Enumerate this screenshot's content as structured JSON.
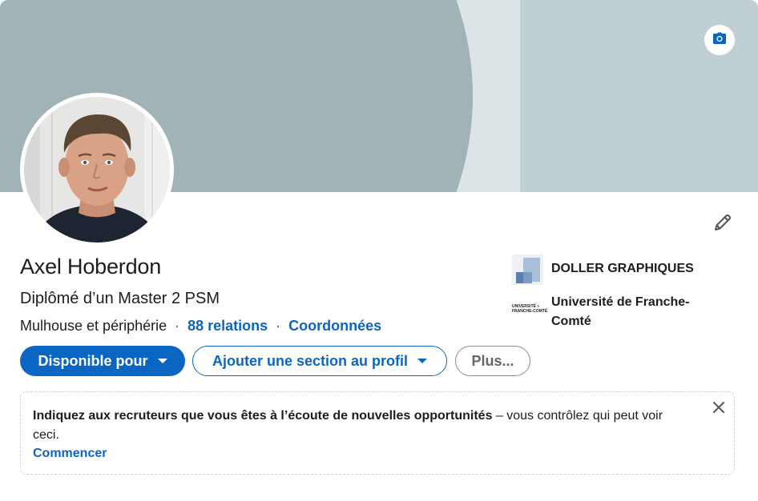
{
  "profile": {
    "name": "Axel Hoberdon",
    "headline": "Diplômé d’un Master 2 PSM",
    "location": "Mulhouse et périphérie",
    "separator": "·",
    "relations": "88 relations",
    "contact": "Coordonnées"
  },
  "experience": {
    "company": "DOLLER GRAPHIQUES",
    "school": "Université de Franche-Comté",
    "school_logo_lines": [
      "UNIVERSITÉ ≡",
      "FRANCHE-COMTÉ"
    ]
  },
  "actions": {
    "open_to": "Disponible pour",
    "add_section": "Ajouter une section au profil",
    "more": "Plus..."
  },
  "notice": {
    "bold": "Indiquez aux recruteurs que vous êtes à l’écoute de nouvelles opportunités",
    "rest": " – vous contrôlez qui peut voir ceci.",
    "cta": "Commencer"
  },
  "icons": {
    "camera": "camera-icon",
    "edit": "pencil-icon",
    "close": "close-icon"
  },
  "colors": {
    "accent": "#0a66c2",
    "banner": "#a1b3b6",
    "banner_right": "#c0cfd3"
  }
}
